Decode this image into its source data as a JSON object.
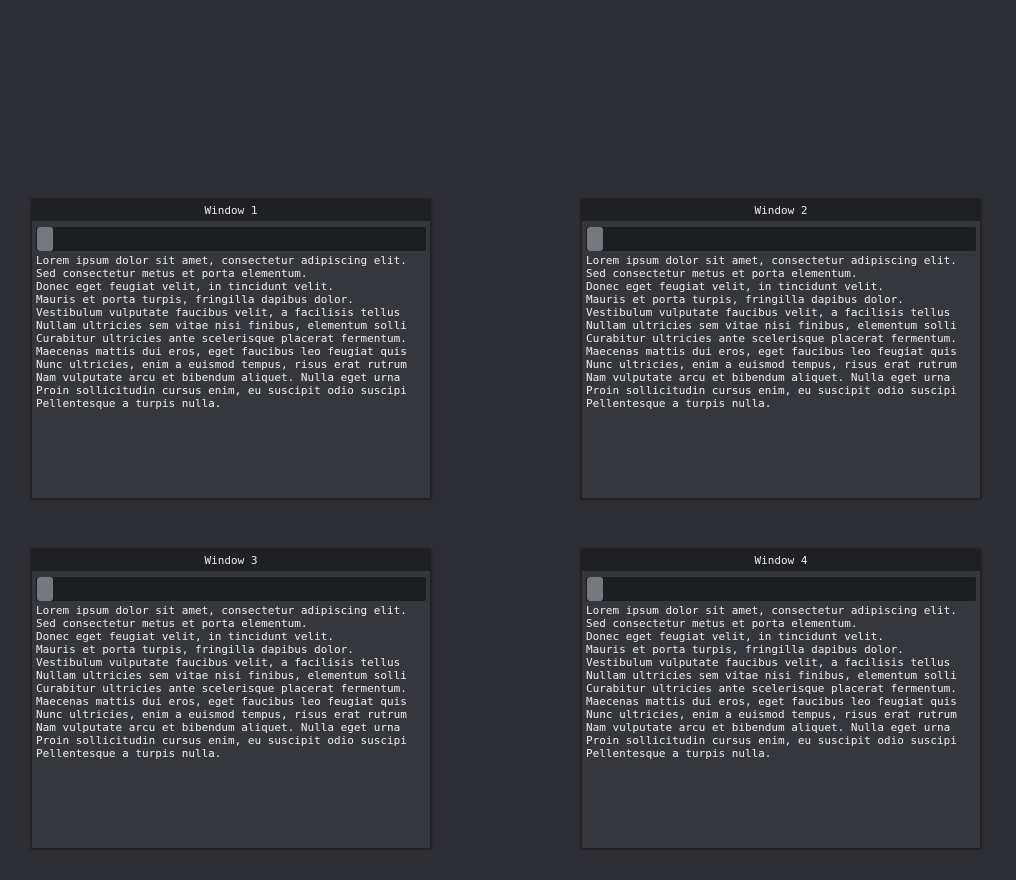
{
  "windows": [
    {
      "title": "Window 1"
    },
    {
      "title": "Window 2"
    },
    {
      "title": "Window 3"
    },
    {
      "title": "Window 4"
    }
  ],
  "content_lines": [
    "Lorem ipsum dolor sit amet, consectetur adipiscing elit.",
    "Sed consectetur metus et porta elementum.",
    "Donec eget feugiat velit, in tincidunt velit.",
    "Mauris et porta turpis, fringilla dapibus dolor.",
    "Vestibulum vulputate faucibus velit, a facilisis tellus",
    "Nullam ultricies sem vitae nisi finibus, elementum solli",
    "Curabitur ultricies ante scelerisque placerat fermentum.",
    "Maecenas mattis dui eros, eget faucibus leo feugiat quis",
    "Nunc ultricies, enim a euismod tempus, risus erat rutrum",
    "Nam vulputate arcu et bibendum aliquet. Nulla eget urna",
    "Proin sollicitudin cursus enim, eu suscipit odio suscipi",
    "Pellentesque a turpis nulla."
  ],
  "colors": {
    "background": "#2e2f34",
    "window_body": "#36373c",
    "titlebar": "#1f2024",
    "scroll_track": "#1d1e22",
    "scroll_thumb": "#77787d",
    "text": "#ececec"
  }
}
